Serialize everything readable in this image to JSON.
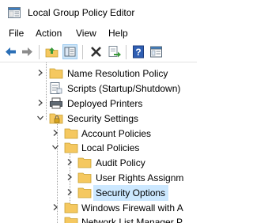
{
  "window": {
    "title": "Local Group Policy Editor"
  },
  "menu": [
    "File",
    "Action",
    "View",
    "Help"
  ],
  "toolbar": {
    "buttons": [
      "back",
      "forward",
      "up-folder",
      "show-hide-tree",
      "delete",
      "export-list",
      "help",
      "properties-view"
    ]
  },
  "tree": {
    "items": [
      {
        "label": "Name Resolution Policy",
        "icon": "folder-icon",
        "toggle": "collapsed"
      },
      {
        "label": "Scripts (Startup/Shutdown)",
        "icon": "script-icon",
        "toggle": "none"
      },
      {
        "label": "Deployed Printers",
        "icon": "printer-icon",
        "toggle": "collapsed"
      },
      {
        "label": "Security Settings",
        "icon": "security-folder-icon",
        "toggle": "expanded"
      },
      {
        "label": "Account Policies",
        "icon": "folder-icon",
        "toggle": "collapsed"
      },
      {
        "label": "Local Policies",
        "icon": "folder-icon",
        "toggle": "expanded"
      },
      {
        "label": "Audit Policy",
        "icon": "folder-icon",
        "toggle": "collapsed"
      },
      {
        "label": "User Rights Assignm",
        "icon": "folder-icon",
        "toggle": "collapsed"
      },
      {
        "label": "Security Options",
        "icon": "folder-icon",
        "toggle": "collapsed",
        "selected": true
      },
      {
        "label": "Windows Firewall with A",
        "icon": "folder-icon",
        "toggle": "collapsed"
      },
      {
        "label": "Network List Manager P",
        "icon": "folder-icon",
        "toggle": "none"
      }
    ]
  },
  "colors": {
    "selection": "#cce8ff",
    "folder": "#f5c860",
    "accent": "#2b6fb6"
  }
}
